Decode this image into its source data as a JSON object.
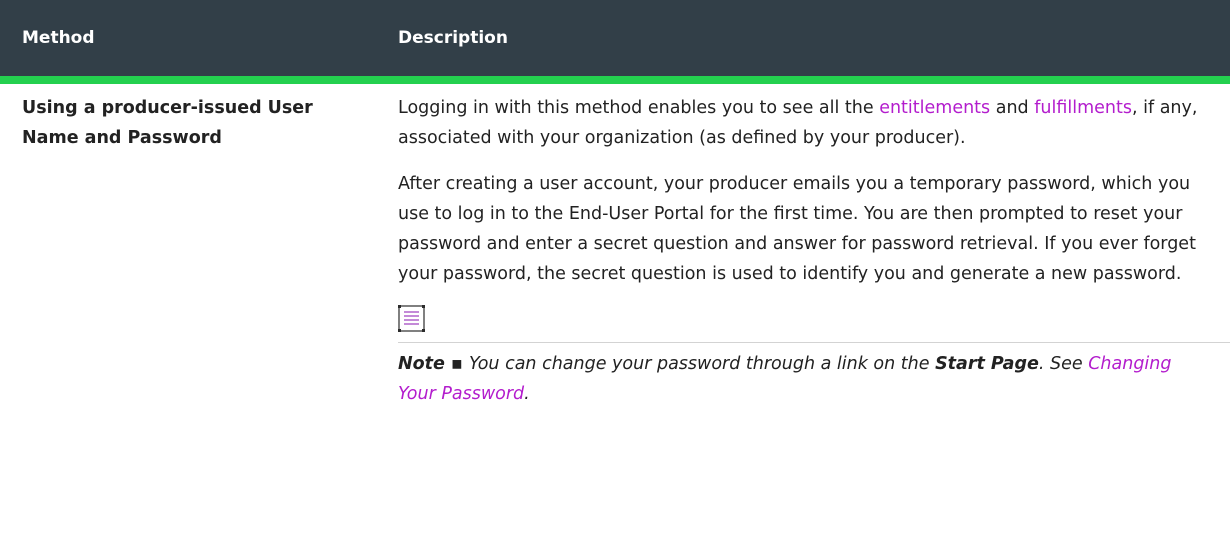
{
  "table": {
    "headers": {
      "method": "Method",
      "description": "Description"
    },
    "row": {
      "method": "Using a producer-issued User Name and Password",
      "para1": {
        "t1": "Logging in with this method enables you to see all the ",
        "link1": "entitlements",
        "t2": " and ",
        "link2": "fulfillments",
        "t3": ", if any, associated with your organization (as defined by your producer)."
      },
      "para2": "After creating a user account, your producer emails you a temporary password, which you use to log in to the End-User Portal for the first time. You are then prompted to reset your password and enter a secret question and answer for password retrieval. If you ever forget your password, the secret question is used to identify you and generate a new password.",
      "note": {
        "icon": "note-icon",
        "label": "Note ▪ ",
        "t1": "You can change your password through a link on the ",
        "bold": "Start Page",
        "t2": ". See ",
        "link": "Changing Your Password",
        "t3": "."
      }
    }
  },
  "colors": {
    "header_bg": "#323f48",
    "header_accent": "#24d04f",
    "link": "#b31dcd"
  }
}
